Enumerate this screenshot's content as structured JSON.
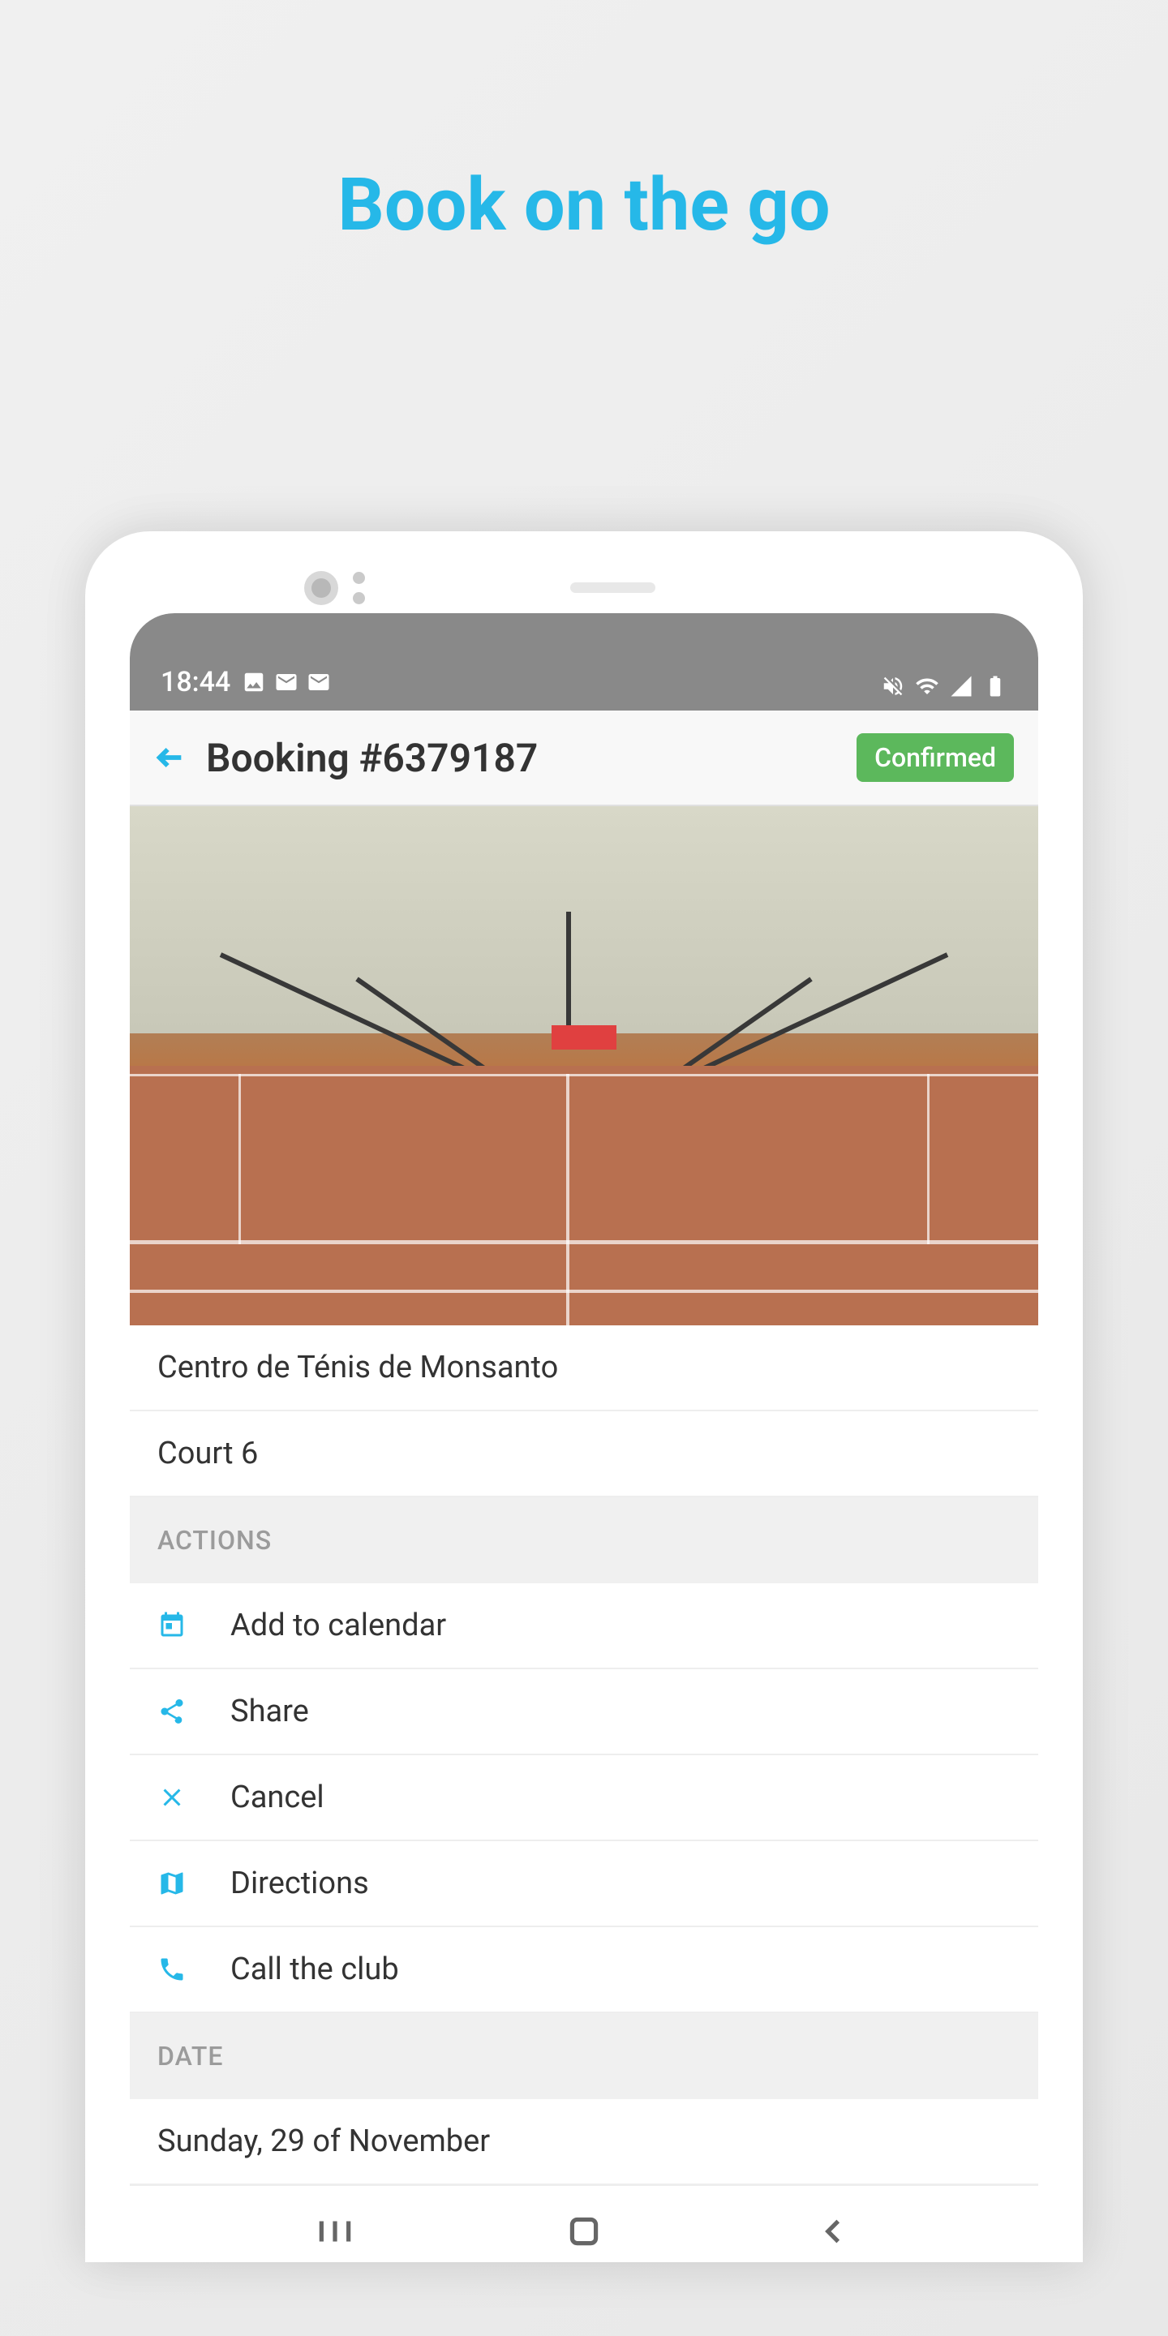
{
  "promo": {
    "title": "Book on the go"
  },
  "statusBar": {
    "time": "18:44"
  },
  "header": {
    "title": "Booking #6379187",
    "statusBadge": "Confirmed"
  },
  "venue": {
    "name": "Centro de Ténis de Monsanto",
    "court": "Court 6"
  },
  "sections": {
    "actions": "ACTIONS",
    "date": "DATE"
  },
  "actions": {
    "addToCalendar": "Add to calendar",
    "share": "Share",
    "cancel": "Cancel",
    "directions": "Directions",
    "callClub": "Call the club"
  },
  "date": {
    "value": "Sunday, 29 of November"
  },
  "colors": {
    "accent": "#26b8e8",
    "success": "#5cb85c"
  }
}
